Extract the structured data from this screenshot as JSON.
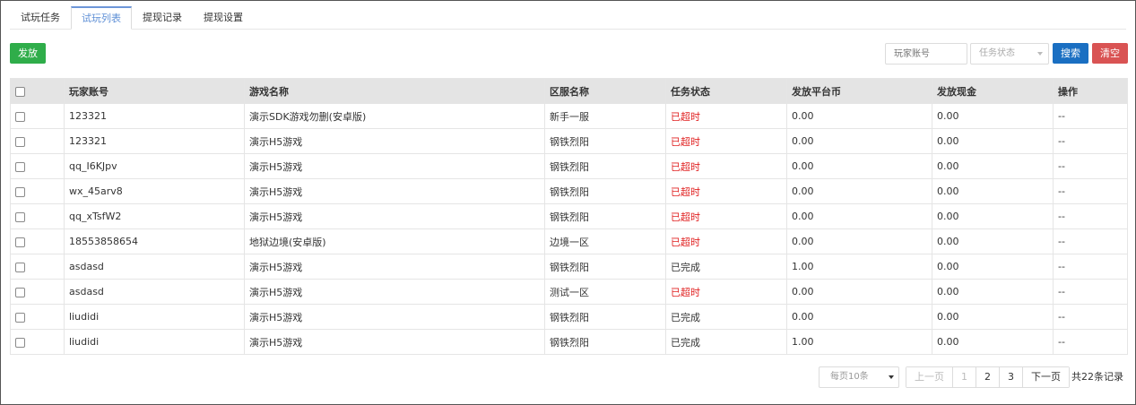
{
  "tabs": [
    {
      "label": "试玩任务"
    },
    {
      "label": "试玩列表"
    },
    {
      "label": "提现记录"
    },
    {
      "label": "提现设置"
    }
  ],
  "toolbar": {
    "issue_label": "发放",
    "player_placeholder": "玩家账号",
    "status_placeholder": "任务状态",
    "search_label": "搜索",
    "clear_label": "清空"
  },
  "colors": {
    "green": "#2fad4a",
    "blue": "#1a6fc2",
    "red": "#d95353",
    "timeout_text": "#e02020",
    "active_tab": "#5e8fd6"
  },
  "table": {
    "headers": [
      "玩家账号",
      "游戏名称",
      "区服名称",
      "任务状态",
      "发放平台币",
      "发放现金",
      "操作"
    ],
    "rows": [
      {
        "account": "123321",
        "game": "演示SDK游戏勿删(安卓版)",
        "server": "新手一服",
        "status": "已超时",
        "coin": "0.00",
        "cash": "0.00",
        "op": "--"
      },
      {
        "account": "123321",
        "game": "演示H5游戏",
        "server": "钢铁烈阳",
        "status": "已超时",
        "coin": "0.00",
        "cash": "0.00",
        "op": "--"
      },
      {
        "account": "qq_I6KJpv",
        "game": "演示H5游戏",
        "server": "钢铁烈阳",
        "status": "已超时",
        "coin": "0.00",
        "cash": "0.00",
        "op": "--"
      },
      {
        "account": "wx_45arv8",
        "game": "演示H5游戏",
        "server": "钢铁烈阳",
        "status": "已超时",
        "coin": "0.00",
        "cash": "0.00",
        "op": "--"
      },
      {
        "account": "qq_xTsfW2",
        "game": "演示H5游戏",
        "server": "钢铁烈阳",
        "status": "已超时",
        "coin": "0.00",
        "cash": "0.00",
        "op": "--"
      },
      {
        "account": "18553858654",
        "game": "地狱边境(安卓版)",
        "server": "边境一区",
        "status": "已超时",
        "coin": "0.00",
        "cash": "0.00",
        "op": "--"
      },
      {
        "account": "asdasd",
        "game": "演示H5游戏",
        "server": "钢铁烈阳",
        "status": "已完成",
        "coin": "1.00",
        "cash": "0.00",
        "op": "--"
      },
      {
        "account": "asdasd",
        "game": "演示H5游戏",
        "server": "测试一区",
        "status": "已超时",
        "coin": "0.00",
        "cash": "0.00",
        "op": "--"
      },
      {
        "account": "liudidi",
        "game": "演示H5游戏",
        "server": "钢铁烈阳",
        "status": "已完成",
        "coin": "0.00",
        "cash": "0.00",
        "op": "--"
      },
      {
        "account": "liudidi",
        "game": "演示H5游戏",
        "server": "钢铁烈阳",
        "status": "已完成",
        "coin": "1.00",
        "cash": "0.00",
        "op": "--"
      }
    ]
  },
  "pagination": {
    "per_page": "每页10条",
    "prev": "上一页",
    "pages": [
      "1",
      "2",
      "3"
    ],
    "next": "下一页",
    "total": "共22条记录"
  }
}
